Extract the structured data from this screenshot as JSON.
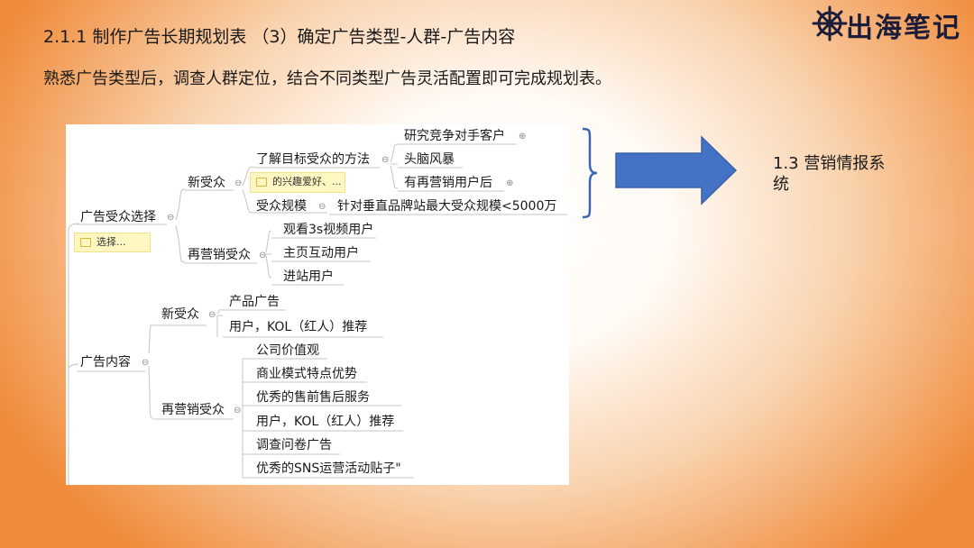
{
  "header": {
    "title": "2.1.1 制作广告长期规划表 （3）确定广告类型-人群-广告内容",
    "subtitle": "熟悉广告类型后，调查人群定位，结合不同类型广告灵活配置即可完成规划表。"
  },
  "logo": {
    "text": "出海笔记"
  },
  "mindmap": {
    "ad_audience": {
      "label": "广告受众选择",
      "note": "选择...",
      "new_audience": {
        "label": "新受众",
        "method": {
          "label": "了解目标受众的方法",
          "items": [
            "研究竞争对手客户",
            "头脑风暴",
            "有再营销用户后"
          ]
        },
        "method_note": "的兴趣爱好、...",
        "scale": {
          "label": "受众规模",
          "value": "针对垂直品牌站最大受众规模<5000万"
        }
      },
      "remarketing": {
        "label": "再营销受众",
        "items": [
          "观看3s视频用户",
          "主页互动用户",
          "进站用户"
        ]
      }
    },
    "ad_content": {
      "label": "广告内容",
      "new_audience": {
        "label": "新受众",
        "items": [
          "产品广告",
          "用户，KOL（红人）推荐"
        ]
      },
      "remarketing": {
        "label": "再营销受众",
        "items": [
          "公司价值观",
          "商业模式特点优势",
          "优秀的售前售后服务",
          "用户，KOL（红人）推荐",
          "调查问卷广告",
          "优秀的SNS运营活动贴子\""
        ]
      }
    }
  },
  "side_label": "1.3 营销情报系统",
  "colors": {
    "arrow_fill": "#4472c4",
    "arrow_stroke": "#3a62a8",
    "bracket": "#3b66b8",
    "map_lines": "#c4c4c4"
  }
}
